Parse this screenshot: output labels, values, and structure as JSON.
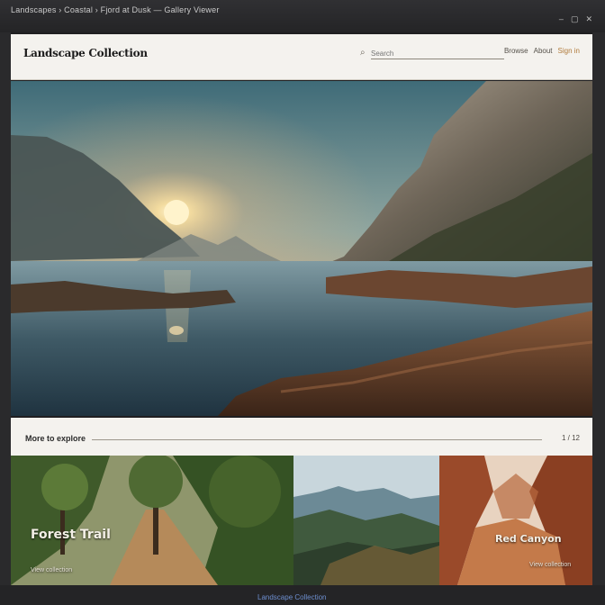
{
  "window": {
    "crumb": "Landscapes › Coastal › Fjord at Dusk — Gallery Viewer",
    "controls": [
      "–",
      "▢",
      "✕"
    ]
  },
  "header": {
    "brand": "Landscape Collection",
    "search_placeholder": "Search",
    "nav": [
      "Browse",
      "About",
      "Sign in"
    ]
  },
  "hero": {
    "alt_name": "Fjord at sunset"
  },
  "section": {
    "title": "More to explore",
    "count": "1 / 12"
  },
  "gallery": [
    {
      "caption": "Forest Trail",
      "meta": "View collection"
    },
    {
      "caption": "",
      "meta": ""
    },
    {
      "caption": "Red Canyon",
      "meta": "View collection"
    }
  ],
  "footer": {
    "text": "Landscape Collection"
  },
  "colors": {
    "accent": "#b07a3a",
    "header_bg": "#f4f2ee",
    "link": "#6e8fd0"
  }
}
